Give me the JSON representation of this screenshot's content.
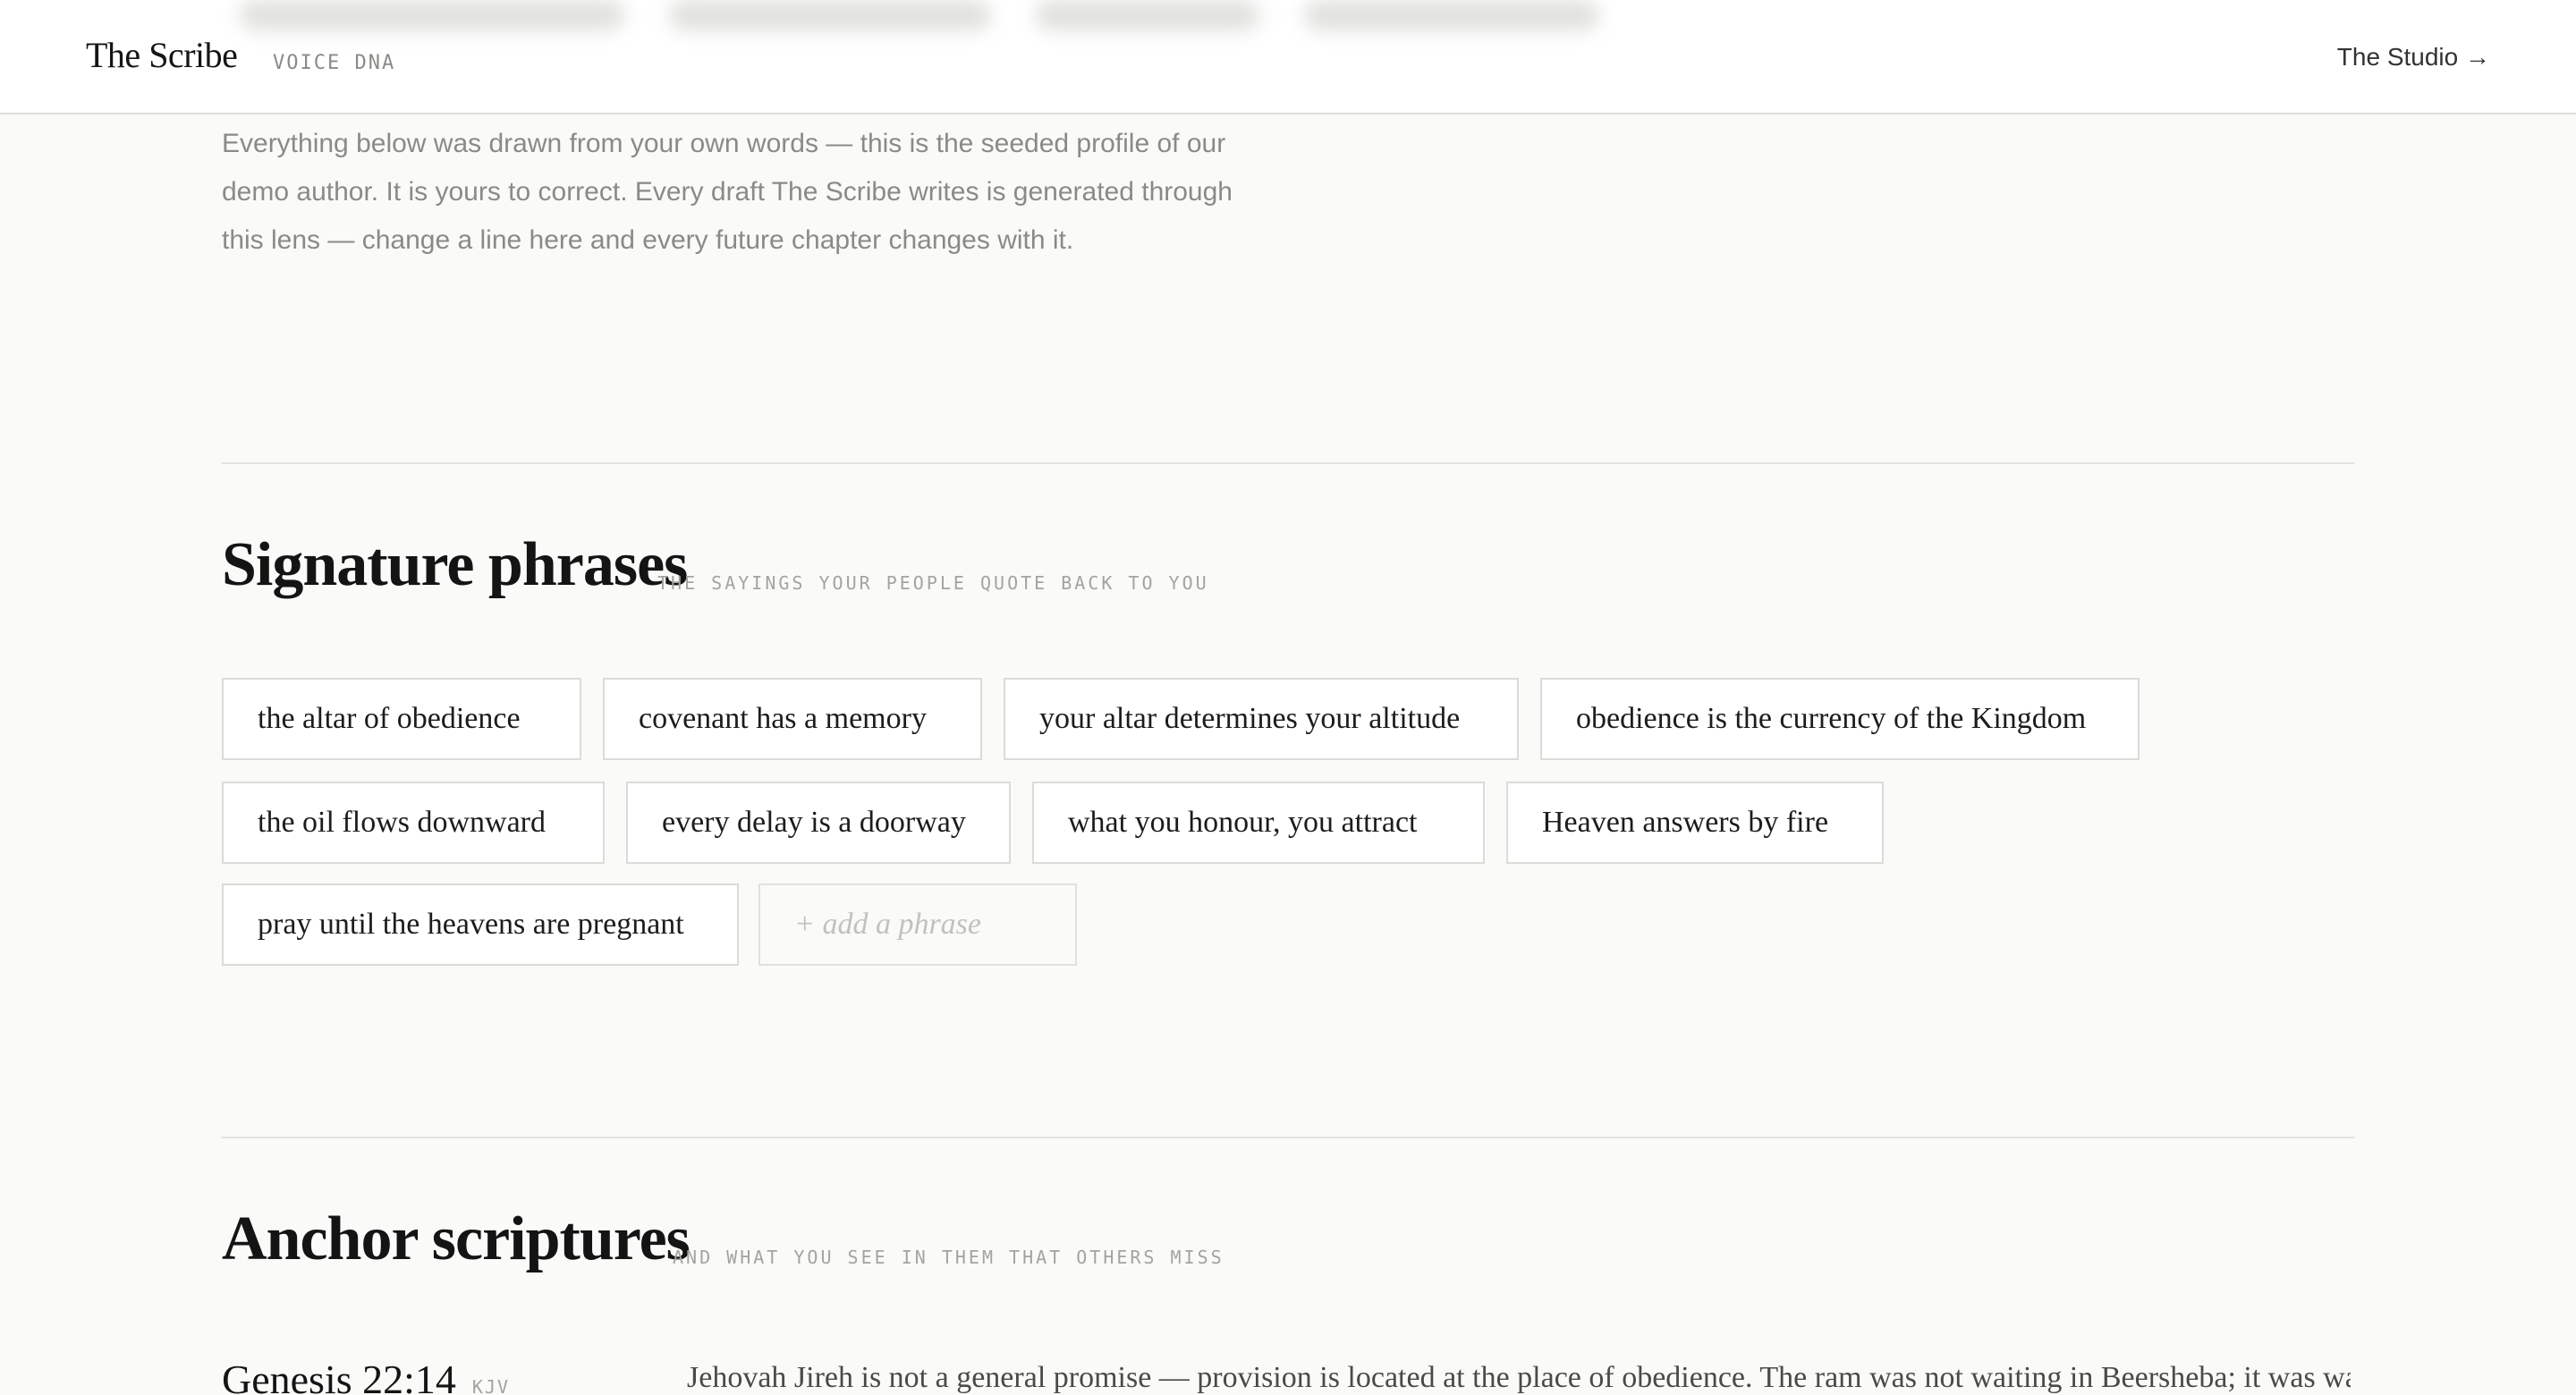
{
  "header": {
    "brand": "The Scribe",
    "section_label": "VOICE DNA",
    "studio_link": "The Studio →"
  },
  "intro": {
    "text": "Everything below was drawn from your own words — this is the seeded profile of our demo author. It is yours to correct. Every draft The Scribe writes is generated through this lens — change a line here and every future chapter changes with it."
  },
  "signature_phrases": {
    "title": "Signature phrases",
    "kicker": "THE SAYINGS YOUR PEOPLE QUOTE BACK TO YOU",
    "phrases": [
      "the altar of obedience",
      "covenant has a memory",
      "your altar determines your altitude",
      "obedience is the currency of the Kingdom",
      "the oil flows downward",
      "every delay is a doorway",
      "what you honour, you attract",
      "Heaven answers by fire",
      "pray until the heavens are pregnant"
    ],
    "add_placeholder": "+ add a phrase"
  },
  "anchor_scriptures": {
    "title": "Anchor scriptures",
    "kicker": "AND WHAT YOU SEE IN THEM THAT OTHERS MISS",
    "items": [
      {
        "reference": "Genesis 22:14",
        "version": "KJV",
        "insight": "Jehovah Jireh is not a general promise — provision is located at the place of obedience. The ram was not waiting in Beersheba; it was waiting"
      }
    ]
  },
  "colors": {
    "background": "#fafaf8",
    "header_background": "#ffffff",
    "rule": "#e3e2de",
    "chip_border": "#dcdbd7",
    "muted_text": "#8b8a86"
  }
}
